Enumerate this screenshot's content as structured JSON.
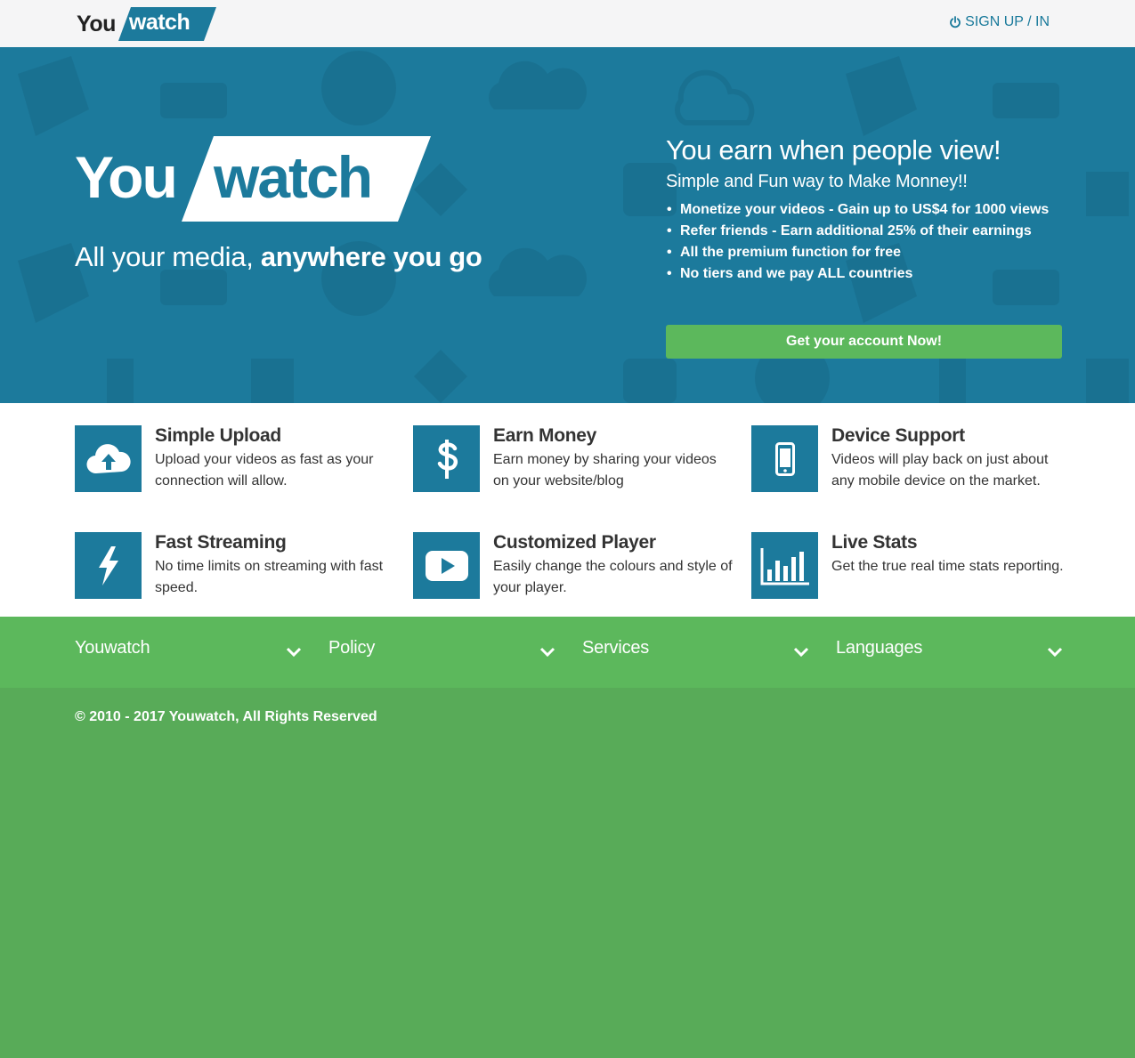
{
  "header": {
    "logo_you": "You",
    "logo_watch": "watch",
    "signup_label": "SIGN UP / IN",
    "signup_icon": "power-icon"
  },
  "hero": {
    "logo_you": "You",
    "logo_watch": "watch",
    "tagline_regular": "All your media, ",
    "tagline_bold": "anywhere you go",
    "headline": "You earn when people view!",
    "subheadline": "Simple and Fun way to Make Monney!!",
    "bullets": [
      "Monetize your videos - Gain up to US$4 for 1000 views",
      "Refer friends - Earn additional 25% of their earnings",
      "All the premium function for free",
      "No tiers and we pay ALL countries"
    ],
    "cta_label": "Get your account Now!"
  },
  "features": [
    {
      "icon": "cloud-upload-icon",
      "title": "Simple Upload",
      "desc": "Upload your videos as fast as your connection will allow."
    },
    {
      "icon": "dollar-icon",
      "title": "Earn Money",
      "desc": "Earn money by sharing your videos on your website/blog"
    },
    {
      "icon": "mobile-icon",
      "title": "Device Support",
      "desc": "Videos will play back on just about any mobile device on the market."
    },
    {
      "icon": "lightning-icon",
      "title": "Fast Streaming",
      "desc": "No time limits on streaming with fast speed."
    },
    {
      "icon": "play-icon",
      "title": "Customized Player",
      "desc": "Easily change the colours and style of your player."
    },
    {
      "icon": "bar-chart-icon",
      "title": "Live Stats",
      "desc": "Get the true real time stats reporting."
    }
  ],
  "footer": {
    "sections": [
      "Youwatch",
      "Policy",
      "Services",
      "Languages"
    ],
    "copyright": "© 2010 - 2017 Youwatch, All Rights Reserved"
  },
  "colors": {
    "brand_blue": "#1c7a9c",
    "accent_green": "#5cb85c",
    "footer_green": "#58ab58",
    "topbar_bg": "#f5f5f6"
  }
}
